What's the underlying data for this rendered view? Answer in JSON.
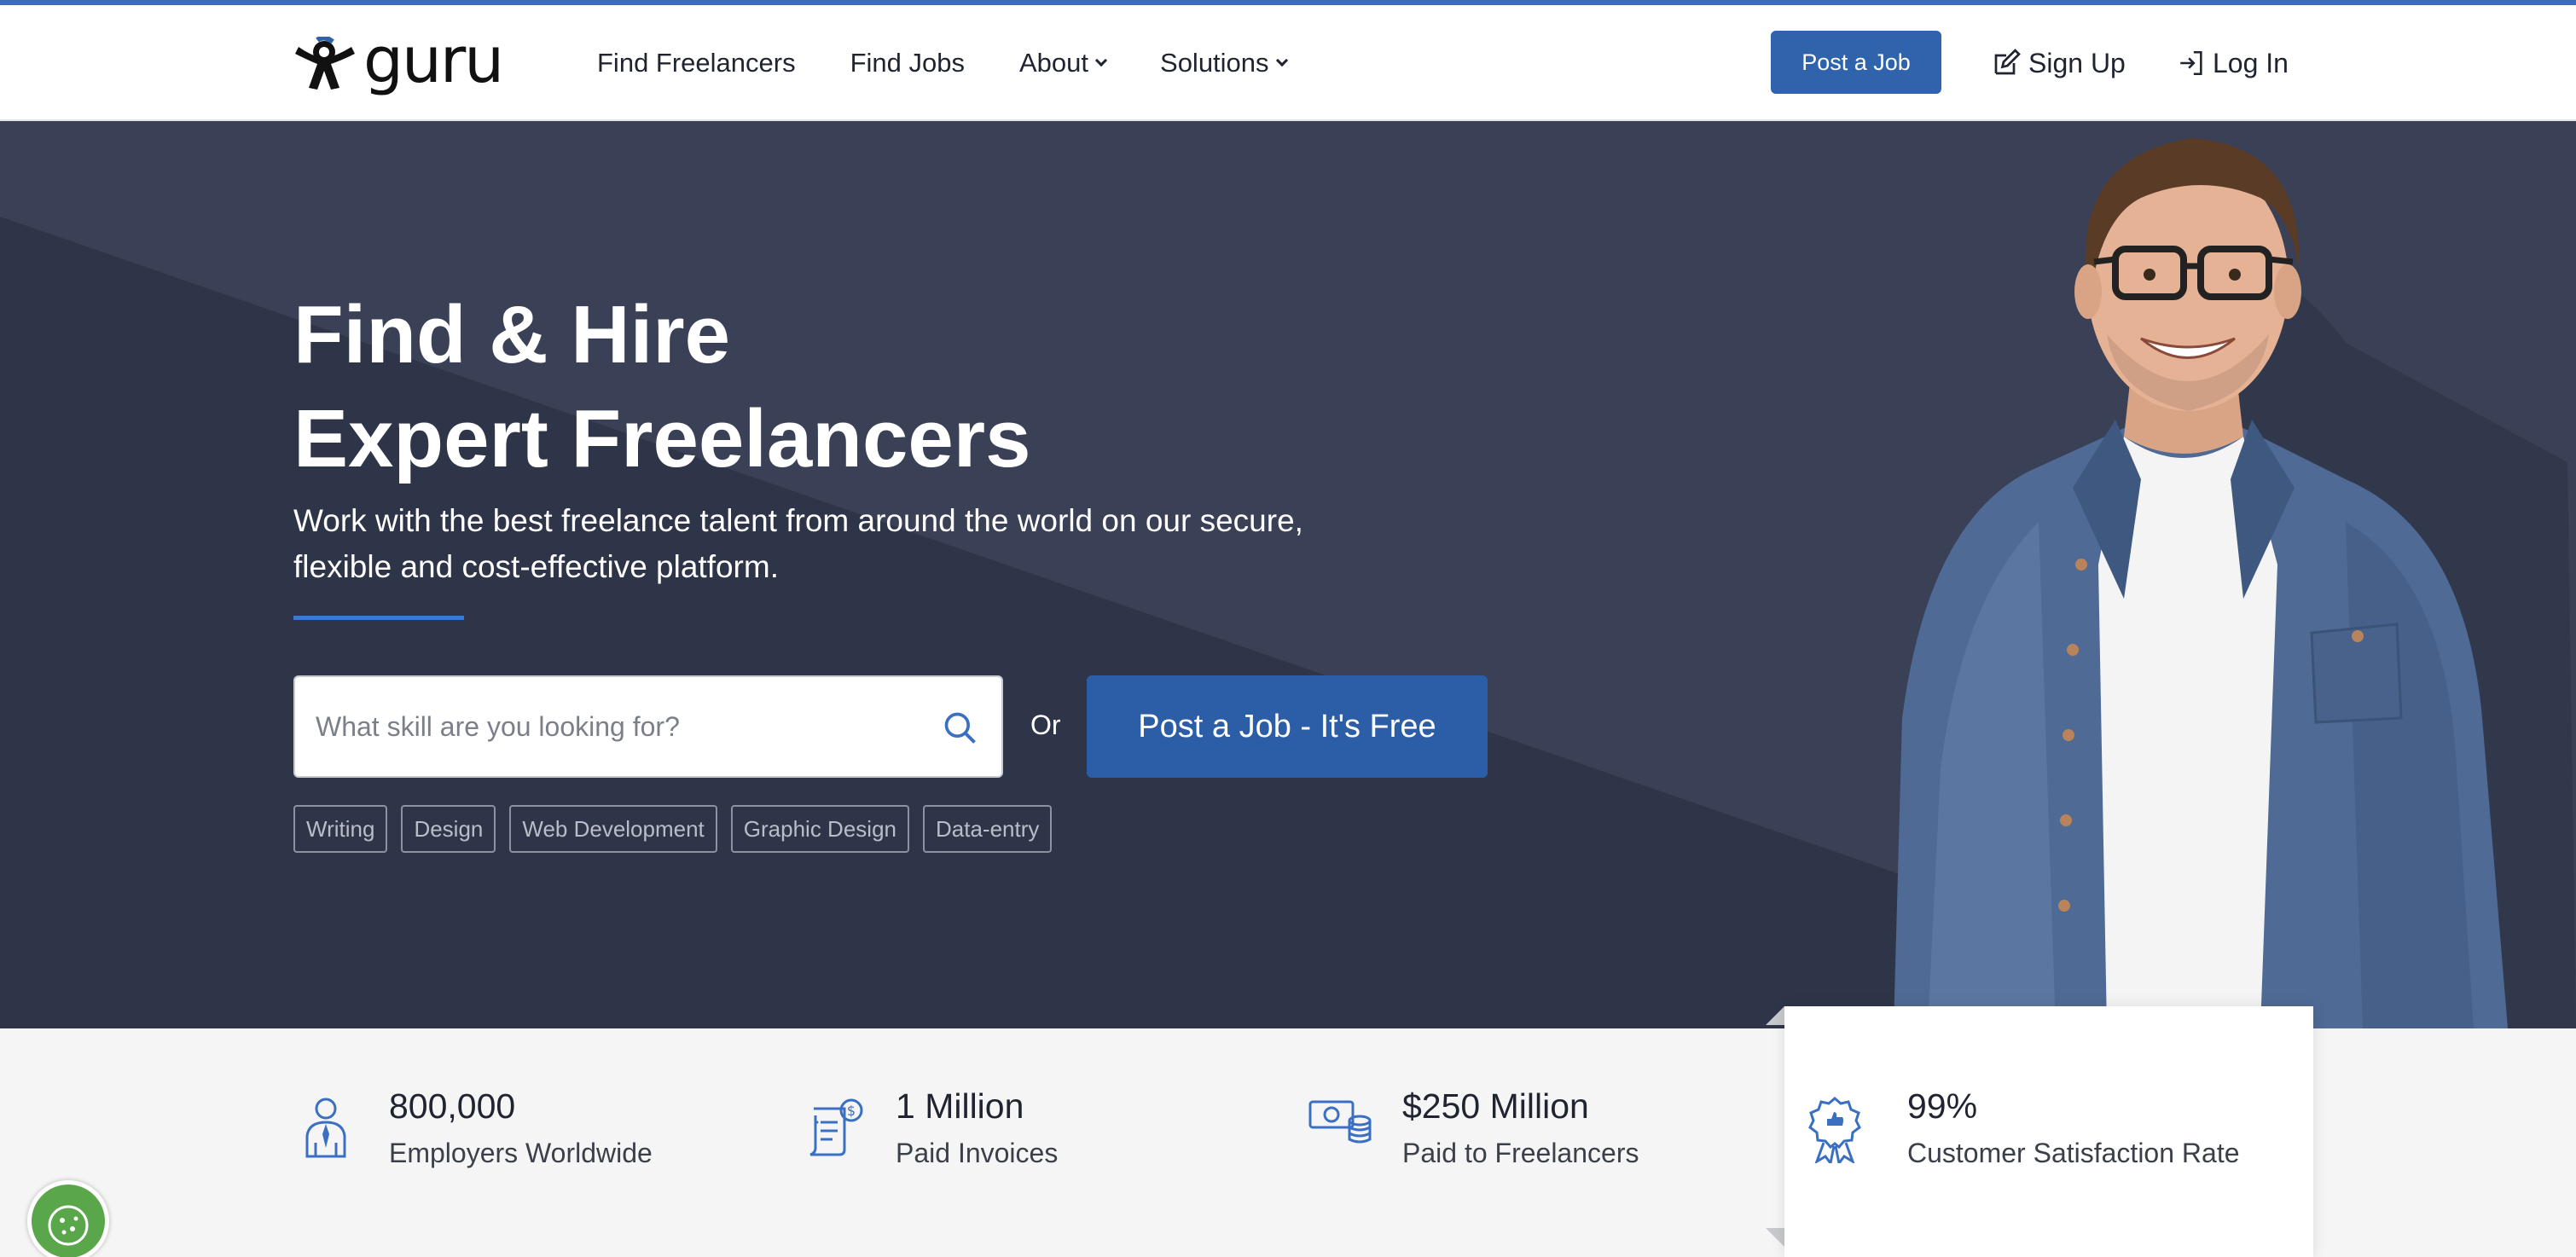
{
  "colors": {
    "accent": "#2f64ac",
    "hero_bg": "#353c51",
    "stripe": "#3d6db5",
    "cookie": "#5aa64b"
  },
  "brand": {
    "logo_text": "guru"
  },
  "nav": {
    "links": [
      "Find Freelancers",
      "Find Jobs",
      "About",
      "Solutions"
    ],
    "post_job": "Post a Job",
    "sign_up": "Sign Up",
    "log_in": "Log In"
  },
  "hero": {
    "title_line1": "Find & Hire",
    "title_line2": "Expert Freelancers",
    "subtitle": "Work with the best freelance talent from around the world on our secure, flexible and cost-effective platform.",
    "search_placeholder": "What skill are you looking for?",
    "or": "Or",
    "post_job_button": "Post a Job - It's Free",
    "tags": [
      "Writing",
      "Design",
      "Web Development",
      "Graphic Design",
      "Data-entry"
    ]
  },
  "stats": [
    {
      "value": "800,000",
      "label": "Employers Worldwide",
      "icon": "employer-icon"
    },
    {
      "value": "1 Million",
      "label": "Paid Invoices",
      "icon": "invoice-icon"
    },
    {
      "value": "$250 Million",
      "label": "Paid to Freelancers",
      "icon": "money-icon"
    },
    {
      "value": "99%",
      "label": "Customer Satisfaction Rate",
      "icon": "award-icon"
    }
  ]
}
